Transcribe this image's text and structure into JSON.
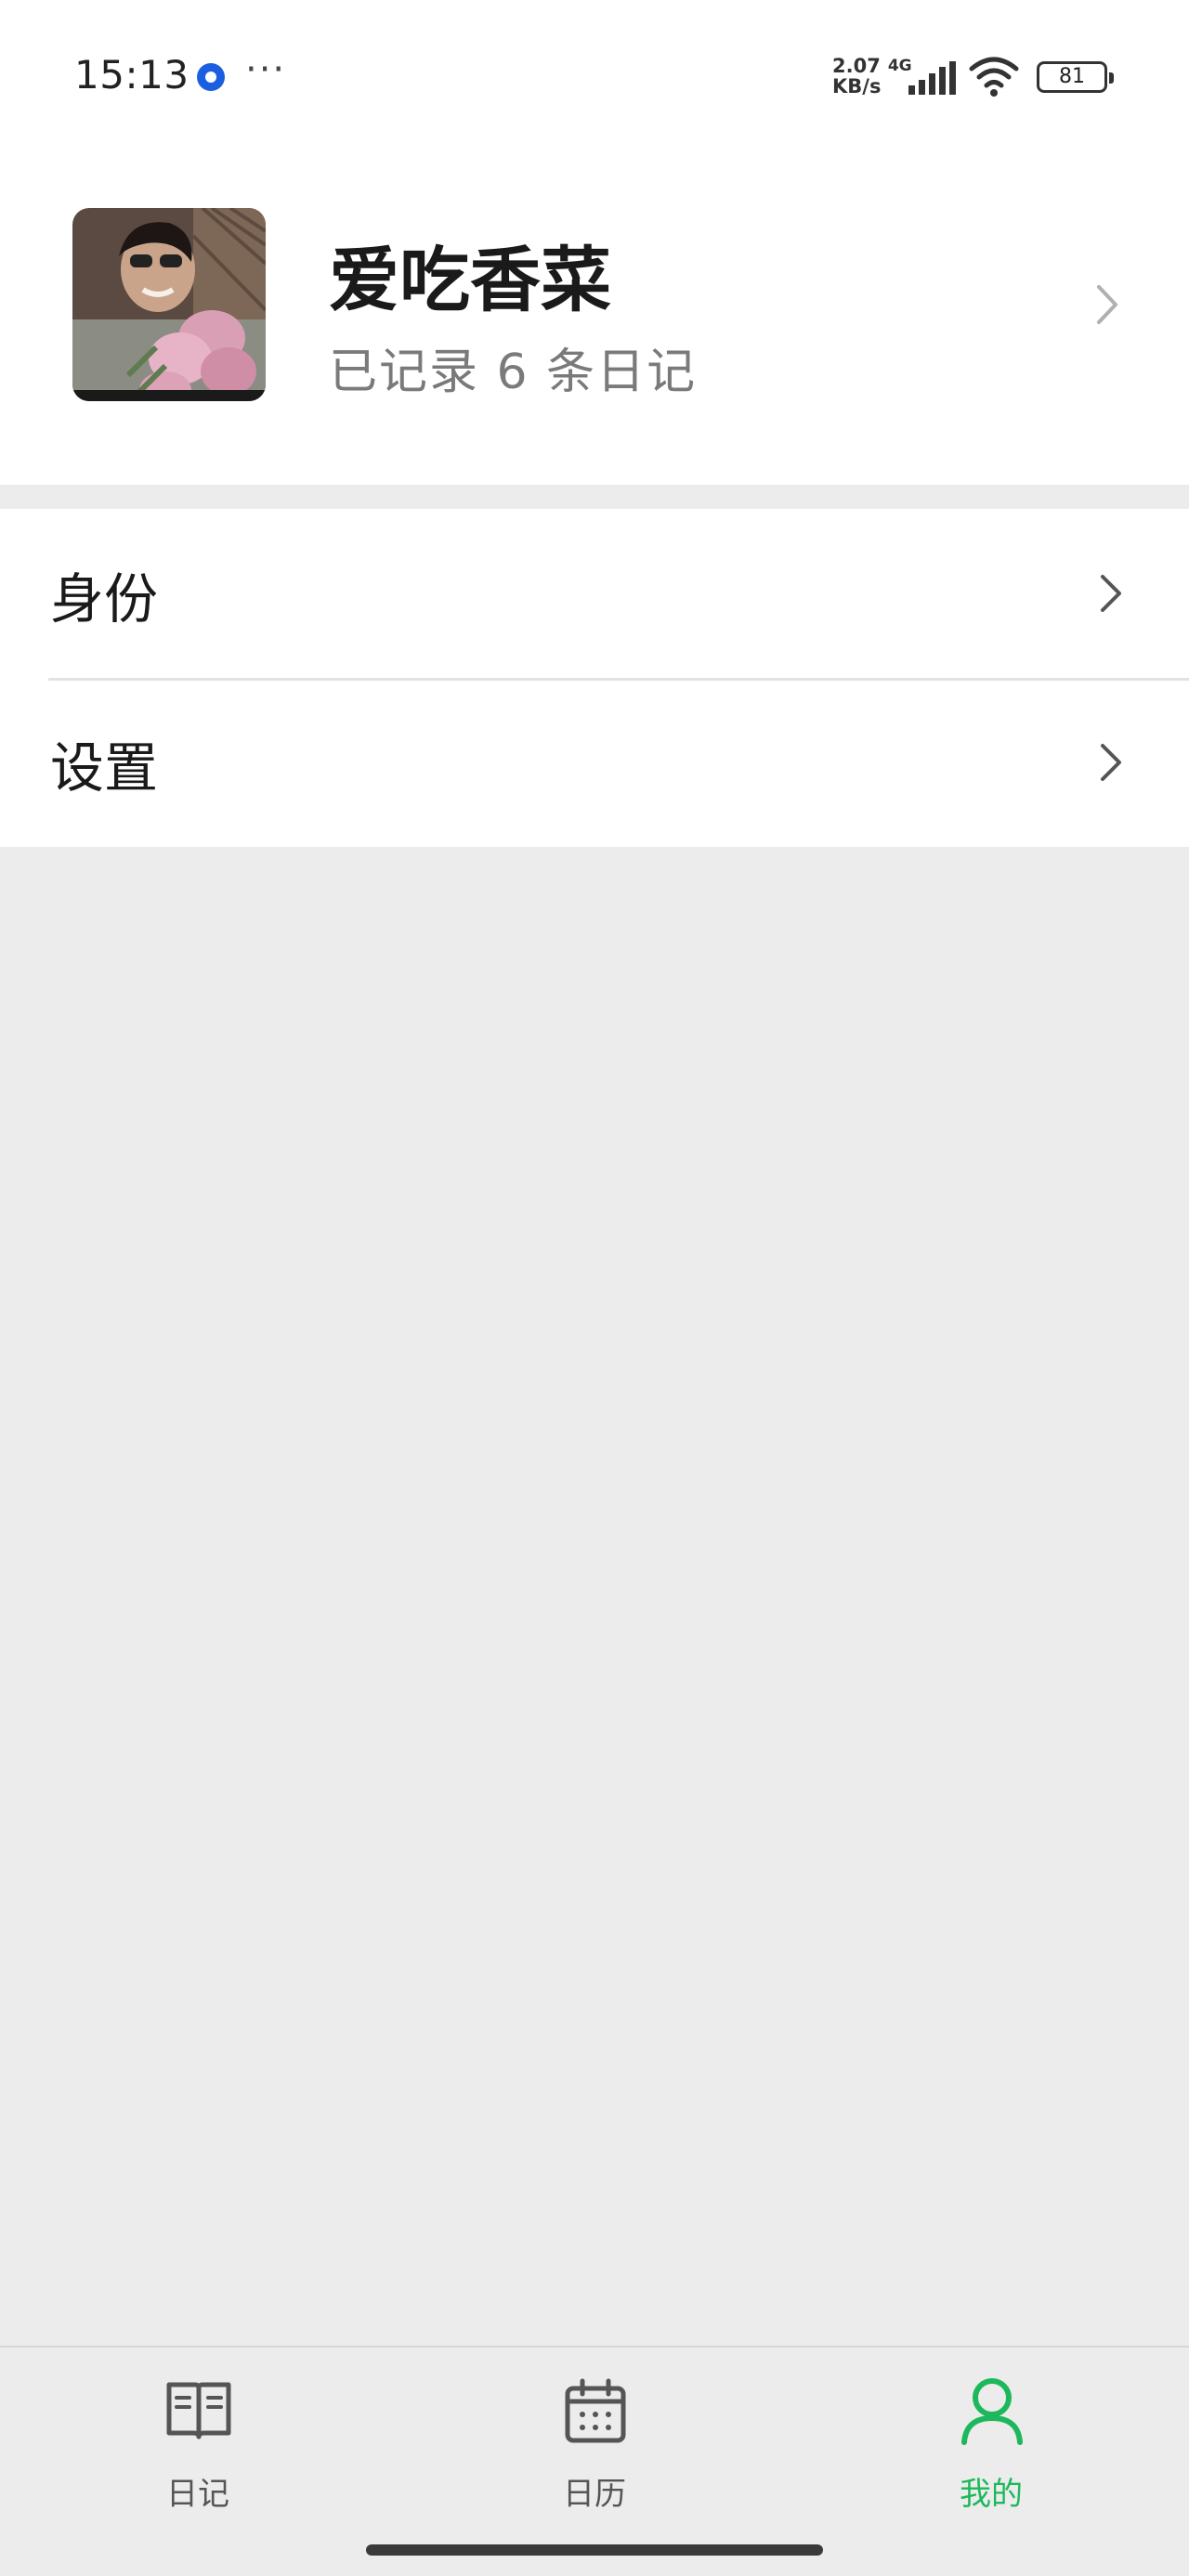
{
  "status_bar": {
    "time": "15:13",
    "net_speed_value": "2.07",
    "net_type": "4G",
    "net_speed_unit": "KB/s",
    "battery": "81"
  },
  "profile": {
    "name": "爱吃香菜",
    "subtitle": "已记录 6 条日记"
  },
  "menu": {
    "items": [
      {
        "label": "身份"
      },
      {
        "label": "设置"
      }
    ]
  },
  "bottom_nav": {
    "tabs": [
      {
        "label": "日记",
        "icon": "book-icon"
      },
      {
        "label": "日历",
        "icon": "calendar-icon"
      },
      {
        "label": "我的",
        "icon": "person-icon"
      }
    ],
    "active_tab": "我的",
    "active_color": "#1eb85c",
    "inactive_color": "#555555"
  }
}
